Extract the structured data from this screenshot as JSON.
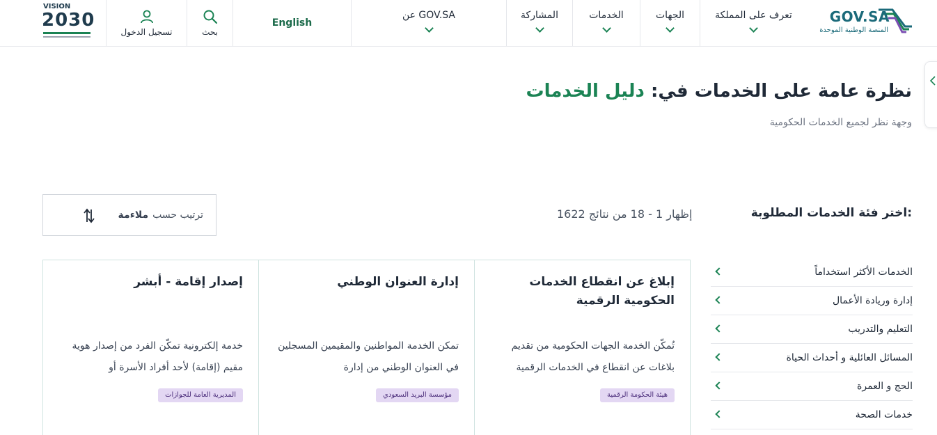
{
  "header": {
    "logo_text": "GOV.SA",
    "logo_sub": "المنصة الوطنية الموحدة",
    "nav": [
      {
        "label": "تعرف على المملكة"
      },
      {
        "label": "الجهات"
      },
      {
        "label": "الخدمات"
      },
      {
        "label": "المشاركة"
      },
      {
        "label": "عن GOV.SA"
      }
    ],
    "english": "English",
    "search": "بحث",
    "login": "تسجيل الدخول",
    "vision_text": "VISION",
    "vision_year": "2030"
  },
  "page": {
    "title_prefix": "نظرة عامة على الخدمات في: ",
    "title_accent": "دليل الخدمات",
    "subtitle": "وجهة نظر لجميع الخدمات الحكومية"
  },
  "filter": {
    "heading": "اختر فئة الخدمات المطلوبة:",
    "results": "إظهار 1 - 18 من نتائج 1622",
    "sort_label": "ترتيب حسب",
    "sort_value": "ملاءمة"
  },
  "categories": [
    {
      "label": "الخدمات الأكثر استخداماً"
    },
    {
      "label": "إدارة وريادة الأعمال"
    },
    {
      "label": "التعليم والتدريب"
    },
    {
      "label": "المسائل العائلية و أحداث الحياة"
    },
    {
      "label": "الحج و العمرة"
    },
    {
      "label": "خدمات الصحة"
    }
  ],
  "cards": [
    {
      "title": "إبلاغ عن انقطاع الخدمات الحكومية الرقمية",
      "desc": "تُمكّن الخدمة الجهات الحكومية من تقديم بلاغات عن انقطاع في الخدمات الرقمية",
      "tag": "هيئة الحكومة الرقمية"
    },
    {
      "title": "إدارة العنوان الوطني",
      "desc": "تمكن الخدمة المواطنين والمقيمين المسجلين في العنوان الوطني من إدارة",
      "tag": "مؤسسة البريد السعودي"
    },
    {
      "title": "إصدار إقامة - أبشر",
      "desc": "خدمة إلكترونية تمكّن الفرد من إصدار هوية مقيم (إقامة) لأحد أفراد الأسرة أو",
      "tag": "المديرية العامة للجوازات"
    }
  ],
  "colors": {
    "accent": "#1b8354",
    "brand": "#1b6a7a",
    "tag_bg": "#e3d7f3"
  }
}
